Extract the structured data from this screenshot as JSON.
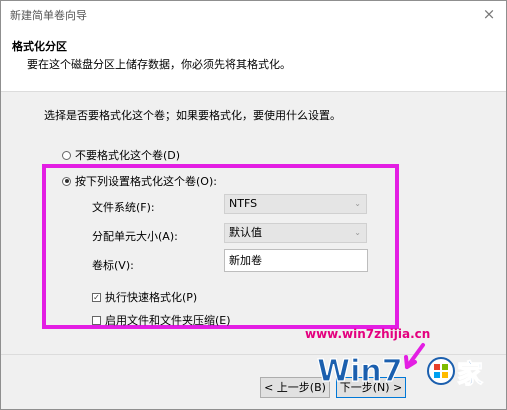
{
  "window": {
    "title": "新建简单卷向导",
    "close_glyph": "×"
  },
  "header": {
    "title": "格式化分区",
    "subtitle": "要在这个磁盘分区上储存数据，你必须先将其格式化。"
  },
  "content": {
    "instruction": "选择是否要格式化这个卷；如果要格式化，要使用什么设置。",
    "option_no_format": "不要格式化这个卷(D)",
    "option_format": "按下列设置格式化这个卷(O):",
    "fs_label": "文件系统(F):",
    "fs_value": "NTFS",
    "alloc_label": "分配单元大小(A):",
    "alloc_value": "默认值",
    "volume_label": "卷标(V):",
    "volume_value": "新加卷",
    "quick_format": "执行快速格式化(P)",
    "compression": "启用文件和文件夹压缩(E)"
  },
  "footer": {
    "back": "< 上一步(B)",
    "next": "下一步(N) >"
  },
  "watermark": {
    "url": "www.win7zhijia.cn",
    "logo_text": "Win7之家"
  },
  "colors": {
    "highlight": "#e31ee3",
    "watermark_url": "#e4007f",
    "logo_blue": "#1b5fae"
  }
}
